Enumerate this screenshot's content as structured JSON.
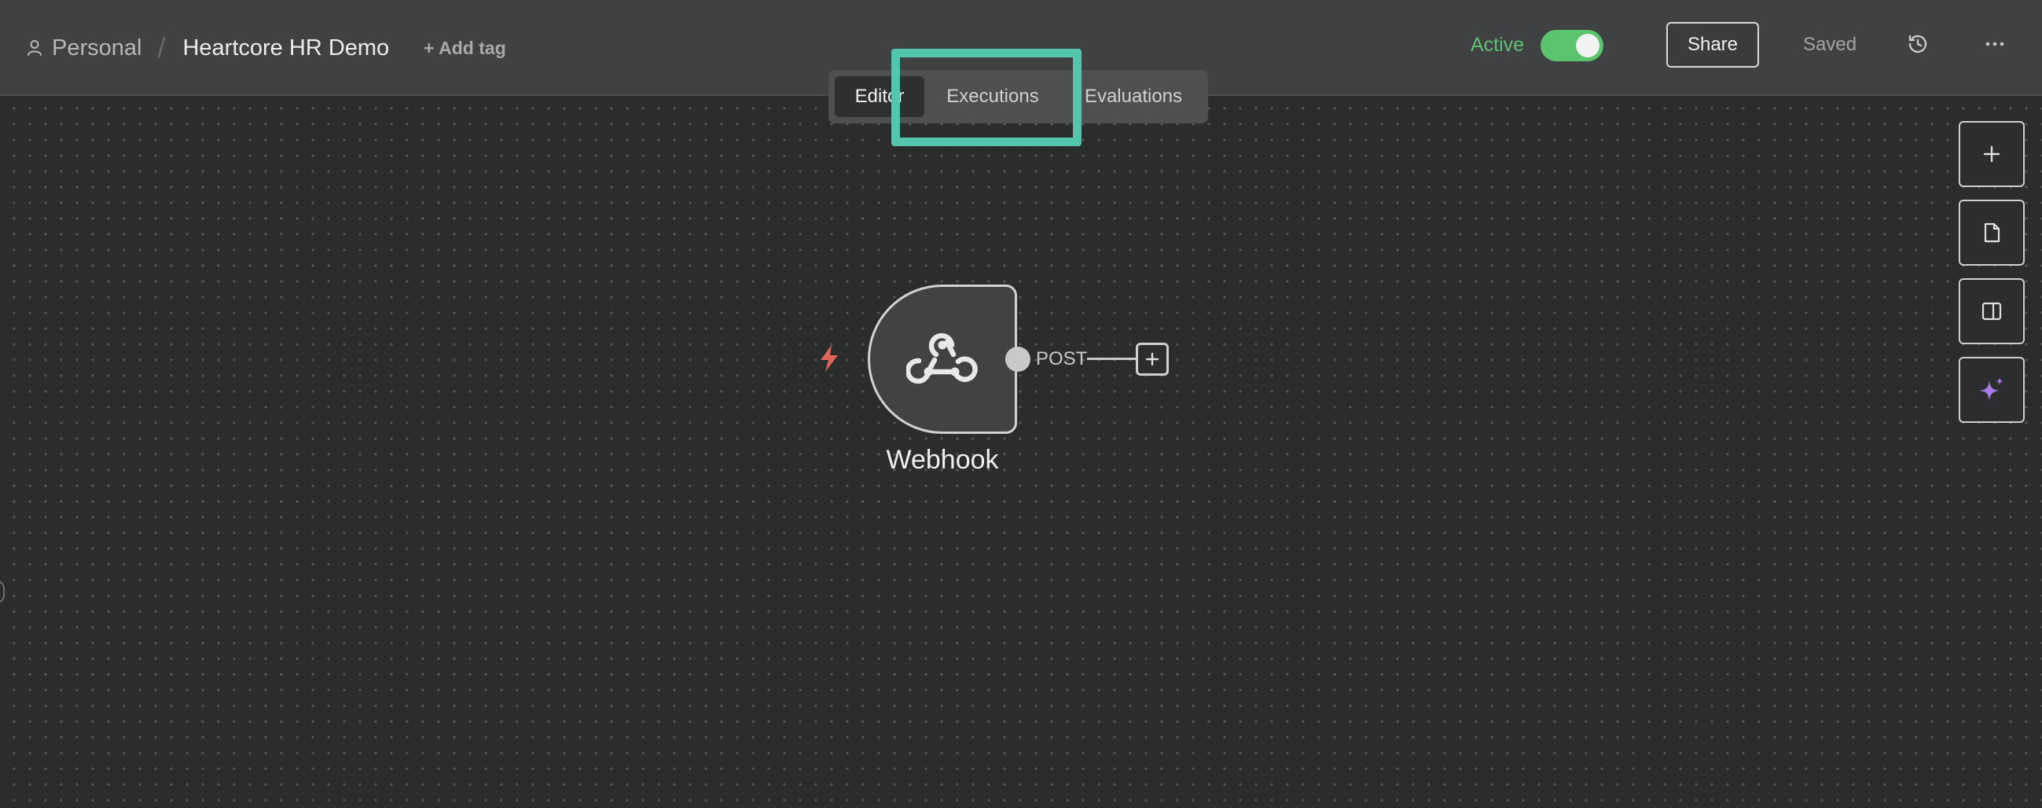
{
  "header": {
    "project_name": "Personal",
    "separator": "/",
    "workflow_name": "Heartcore HR Demo",
    "add_tag_label": "+ Add tag",
    "active_label": "Active",
    "active_state": true,
    "share_label": "Share",
    "saved_label": "Saved"
  },
  "tabs": [
    {
      "label": "Editor",
      "selected": true
    },
    {
      "label": "Executions",
      "selected": false,
      "highlighted": true
    },
    {
      "label": "Evaluations",
      "selected": false
    }
  ],
  "canvas": {
    "node": {
      "name": "Webhook",
      "icon": "webhook-icon",
      "output_label": "POST",
      "trigger_icon": "lightning-icon"
    }
  },
  "toolbar": {
    "icons": [
      "plus-icon",
      "sticky-note-icon",
      "panel-toggle-icon",
      "ai-sparkle-icon"
    ]
  },
  "colors": {
    "background": "#2b2c2c",
    "header": "#404142",
    "active_green": "#5cc36e",
    "highlight": "#55c6ae",
    "trigger_red": "#e0665a",
    "ai_purple": "#a97ae8"
  }
}
